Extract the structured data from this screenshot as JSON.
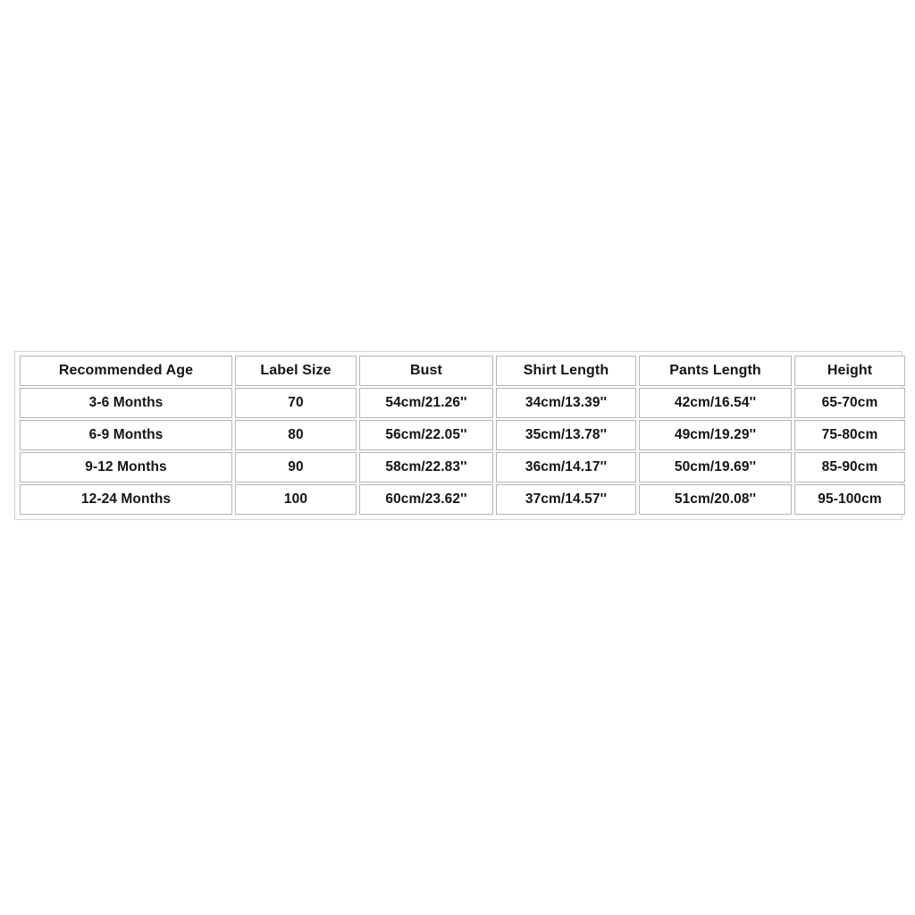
{
  "colors": {
    "page_background": "#ffffff",
    "cell_border": "#b5b5b5",
    "table_border": "#d2d2d2",
    "text": "#141414"
  },
  "size_chart": {
    "columns": [
      "Recommended Age",
      "Label Size",
      "Bust",
      "Shirt Length",
      "Pants Length",
      "Height"
    ],
    "rows": [
      {
        "recommended_age": "3-6 Months",
        "label_size": "70",
        "bust": "54cm/21.26''",
        "shirt_length": "34cm/13.39''",
        "pants_length": "42cm/16.54''",
        "height": "65-70cm"
      },
      {
        "recommended_age": "6-9 Months",
        "label_size": "80",
        "bust": "56cm/22.05''",
        "shirt_length": "35cm/13.78''",
        "pants_length": "49cm/19.29''",
        "height": "75-80cm"
      },
      {
        "recommended_age": "9-12 Months",
        "label_size": "90",
        "bust": "58cm/22.83''",
        "shirt_length": "36cm/14.17''",
        "pants_length": "50cm/19.69''",
        "height": "85-90cm"
      },
      {
        "recommended_age": "12-24 Months",
        "label_size": "100",
        "bust": "60cm/23.62''",
        "shirt_length": "37cm/14.57''",
        "pants_length": "51cm/20.08''",
        "height": "95-100cm"
      }
    ]
  }
}
